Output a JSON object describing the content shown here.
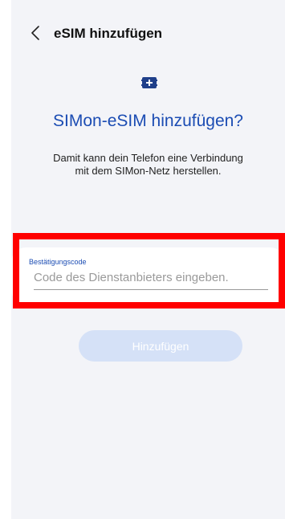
{
  "header": {
    "title": "eSIM hinzufügen",
    "back_icon": "chevron-left-icon"
  },
  "hero": {
    "icon": "esim-add-icon",
    "title": "SIMon-eSIM hinzufügen?",
    "description": "Damit kann dein Telefon eine Verbindung mit dem SIMon-Netz herstellen."
  },
  "form": {
    "label": "Bestätigungscode",
    "value": "",
    "placeholder": "Code des Dienstanbieters eingeben."
  },
  "actions": {
    "add_label": "Hinzufügen",
    "add_enabled": false
  },
  "colors": {
    "accent": "#1b4cb3",
    "background": "#f3f4f8",
    "button_disabled": "#d5e1f7",
    "highlight": "#ff0000"
  }
}
